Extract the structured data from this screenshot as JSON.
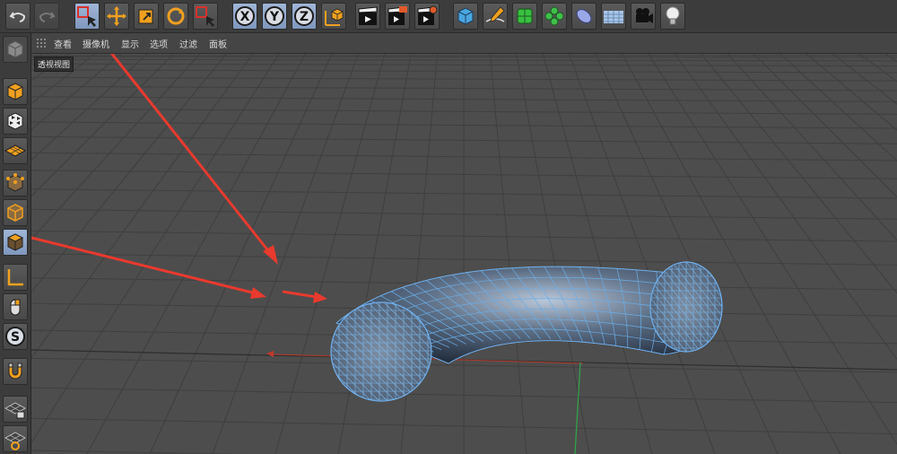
{
  "menu": {
    "items": [
      "查看",
      "摄像机",
      "显示",
      "选项",
      "过滤",
      "面板"
    ]
  },
  "viewport": {
    "label": "透视视图",
    "object": "torus-segment-wireframe"
  },
  "toolbar": {
    "icons": [
      "undo-icon",
      "redo-icon",
      "live-selection-icon",
      "move-icon",
      "scale-icon",
      "rotate-icon",
      "recent-tools-icon",
      "x-axis-lock-icon",
      "y-axis-lock-icon",
      "z-axis-lock-icon",
      "world-coordinate-icon",
      "render-view-icon",
      "render-to-picture-viewer-icon",
      "render-settings-icon",
      "cube-object-icon",
      "pen-spline-icon",
      "subdivision-surface-icon",
      "cloner-icon",
      "deformer-icon",
      "floor-icon",
      "camera-icon",
      "light-icon"
    ],
    "axis_letters": [
      "X",
      "Y",
      "Z"
    ]
  },
  "sidebar": {
    "icons": [
      "make-editable-icon",
      "model-mode-icon",
      "texture-mode-icon",
      "workplane-icon",
      "points-mode-icon",
      "edges-mode-icon",
      "polygons-mode-icon",
      "axis-mode-icon",
      "tweak-mode-icon",
      "solo-mode-icon",
      "snap-icon",
      "lock-workplane-icon",
      "planar-workplane-icon"
    ],
    "solo_letter": "S"
  },
  "colors": {
    "accent_selected": "#8ea6cc",
    "wireframe": "#64a8e8",
    "annotation_arrow": "#e83a2e",
    "grid": "#3f3f3f",
    "viewport_bg": "#4d4d4d"
  }
}
